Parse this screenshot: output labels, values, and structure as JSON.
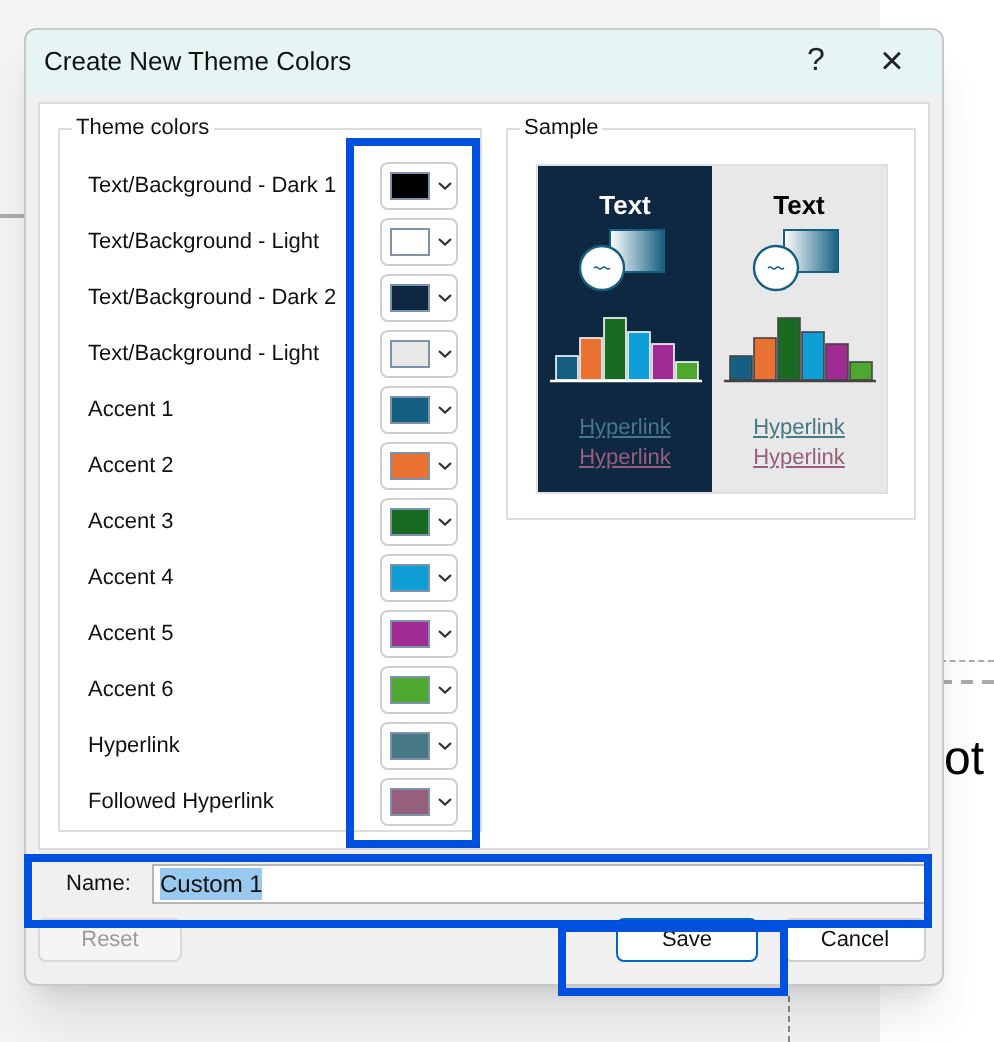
{
  "window": {
    "title": "Create New Theme Colors",
    "help": "?",
    "close": "×"
  },
  "theme_colors": {
    "title": "Theme colors",
    "rows": [
      {
        "label": "Text/Background - Dark 1",
        "color": "#000000"
      },
      {
        "label": "Text/Background - Light",
        "color": "#ffffff"
      },
      {
        "label": "Text/Background - Dark 2",
        "color": "#0e2841"
      },
      {
        "label": "Text/Background - Light",
        "color": "#e8e8e8"
      },
      {
        "label": "Accent 1",
        "color": "#156082"
      },
      {
        "label": "Accent 2",
        "color": "#e97132"
      },
      {
        "label": "Accent 3",
        "color": "#196b24"
      },
      {
        "label": "Accent 4",
        "color": "#0f9ed5"
      },
      {
        "label": "Accent 5",
        "color": "#a02b93"
      },
      {
        "label": "Accent 6",
        "color": "#4ea72e"
      },
      {
        "label": "Hyperlink",
        "color": "#467886"
      },
      {
        "label": "Followed Hyperlink",
        "color": "#96607d"
      }
    ]
  },
  "sample": {
    "title": "Sample",
    "panels": [
      {
        "kind": "dark",
        "heading": "Text",
        "hyperlink": "Hyperlink",
        "followed_hyperlink": "Hyperlink"
      },
      {
        "kind": "light",
        "heading": "Text",
        "hyperlink": "Hyperlink",
        "followed_hyperlink": "Hyperlink"
      }
    ]
  },
  "name": {
    "label": "Name:",
    "value": "Custom 1",
    "text_selected": true
  },
  "buttons": [
    {
      "label": "Reset",
      "disabled": true
    },
    {
      "label": "Save",
      "disabled": false,
      "default": true
    },
    {
      "label": "Cancel",
      "disabled": false,
      "default": false
    }
  ],
  "background": {
    "text": "ot"
  }
}
